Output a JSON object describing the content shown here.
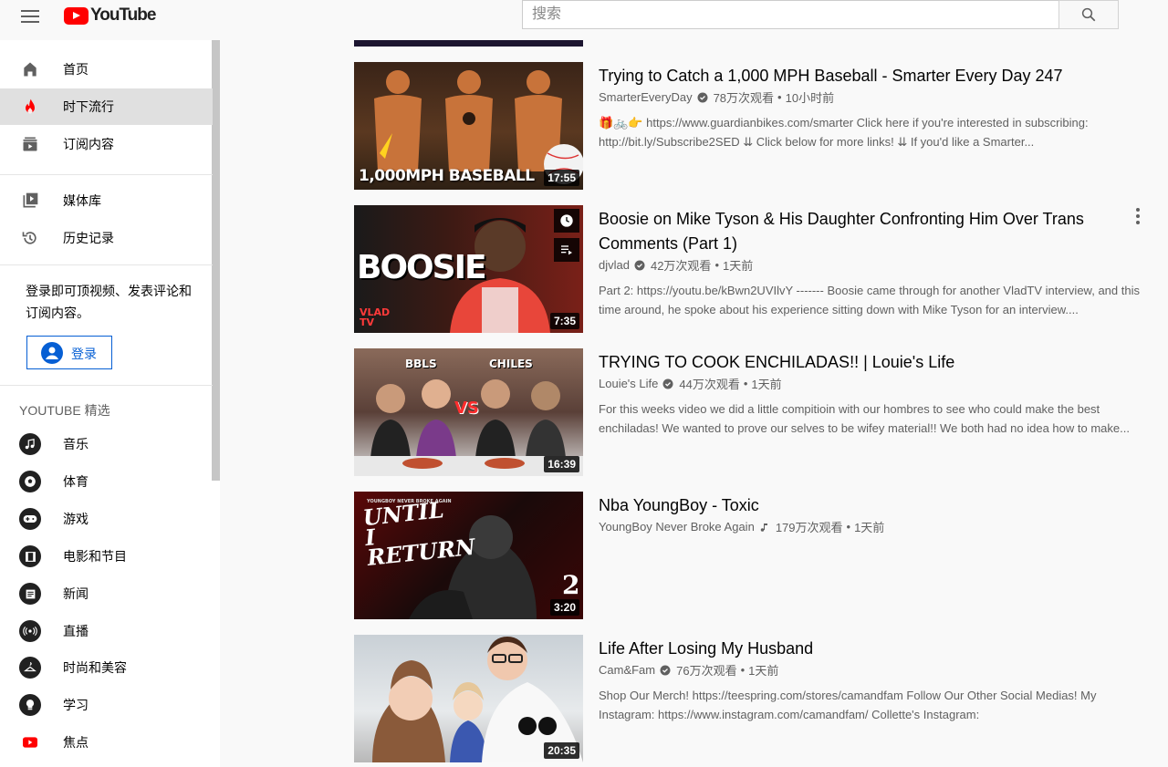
{
  "header": {
    "logo_text": "YouTube",
    "search_placeholder": "搜索"
  },
  "sidebar": {
    "main_items": [
      {
        "label": "首页",
        "icon": "home-icon"
      },
      {
        "label": "时下流行",
        "icon": "trending-icon",
        "active": true
      },
      {
        "label": "订阅内容",
        "icon": "subscriptions-icon"
      }
    ],
    "library_items": [
      {
        "label": "媒体库",
        "icon": "library-icon"
      },
      {
        "label": "历史记录",
        "icon": "history-icon"
      }
    ],
    "signin_prompt": "登录即可顶视频、发表评论和订阅内容。",
    "signin_label": "登录",
    "section_title": "YOUTUBE 精选",
    "featured_items": [
      {
        "label": "音乐",
        "icon": "music-icon"
      },
      {
        "label": "体育",
        "icon": "sports-icon"
      },
      {
        "label": "游戏",
        "icon": "gaming-icon"
      },
      {
        "label": "电影和节目",
        "icon": "movies-icon"
      },
      {
        "label": "新闻",
        "icon": "news-icon"
      },
      {
        "label": "直播",
        "icon": "live-icon"
      },
      {
        "label": "时尚和美容",
        "icon": "fashion-icon"
      },
      {
        "label": "学习",
        "icon": "learning-icon"
      },
      {
        "label": "焦点",
        "icon": "spotlight-icon"
      }
    ]
  },
  "videos": [
    {
      "title": "Trying to Catch a 1,000 MPH Baseball - Smarter Every Day 247",
      "channel": "SmarterEveryDay",
      "badge": "verified",
      "views": "78万次观看",
      "age": "10小时前",
      "duration": "17:55",
      "thumb_text": "1,000MPH BASEBALL",
      "description": "🎁🚲👉 https://www.guardianbikes.com/smarter Click here if you're interested in subscribing: http://bit.ly/Subscribe2SED ⇊ Click below for more links! ⇊ If you'd like a Smarter..."
    },
    {
      "title": "Boosie on Mike Tyson & His Daughter Confronting Him Over Trans Comments (Part 1)",
      "channel": "djvlad",
      "badge": "verified",
      "views": "42万次观看",
      "age": "1天前",
      "duration": "7:35",
      "thumb_text": "BOOSIE",
      "thumb_sub": "VLAD TV",
      "description": "Part 2: https://youtu.be/kBwn2UVIlvY ------- Boosie came through for another VladTV interview, and this time around, he spoke about his experience sitting down with Mike Tyson for an interview...."
    },
    {
      "title": "TRYING TO COOK ENCHILADAS!! | Louie's Life",
      "channel": "Louie's Life",
      "badge": "verified",
      "views": "44万次观看",
      "age": "1天前",
      "duration": "16:39",
      "thumb_text_left": "BBLS",
      "thumb_text_right": "CHILES",
      "thumb_vs": "VS",
      "description": "For this weeks video we did a little compitioin with our hombres to see who could make the best enchiladas! We wanted to prove our selves to be wifey material!! We both had no idea how to make..."
    },
    {
      "title": "Nba YoungBoy - Toxic",
      "channel": "YoungBoy Never Broke Again",
      "badge": "music",
      "views": "179万次观看",
      "age": "1天前",
      "duration": "3:20",
      "thumb_text": "UNTIL I RETURN",
      "thumb_top": "YOUNGBOY NEVER BROKE AGAIN",
      "thumb_num": "2",
      "description": ""
    },
    {
      "title": "Life After Losing My Husband",
      "channel": "Cam&Fam",
      "badge": "verified",
      "views": "76万次观看",
      "age": "1天前",
      "duration": "20:35",
      "description": "Shop Our Merch! https://teespring.com/stores/camandfam Follow Our Other Social Medias! My Instagram: https://www.instagram.com/camandfam/ Collette's Instagram:"
    }
  ],
  "meta_separator": "•",
  "colors": {
    "brand_red": "#ff0000",
    "link_blue": "#065fd4",
    "active_bg": "#e0e0e0"
  }
}
